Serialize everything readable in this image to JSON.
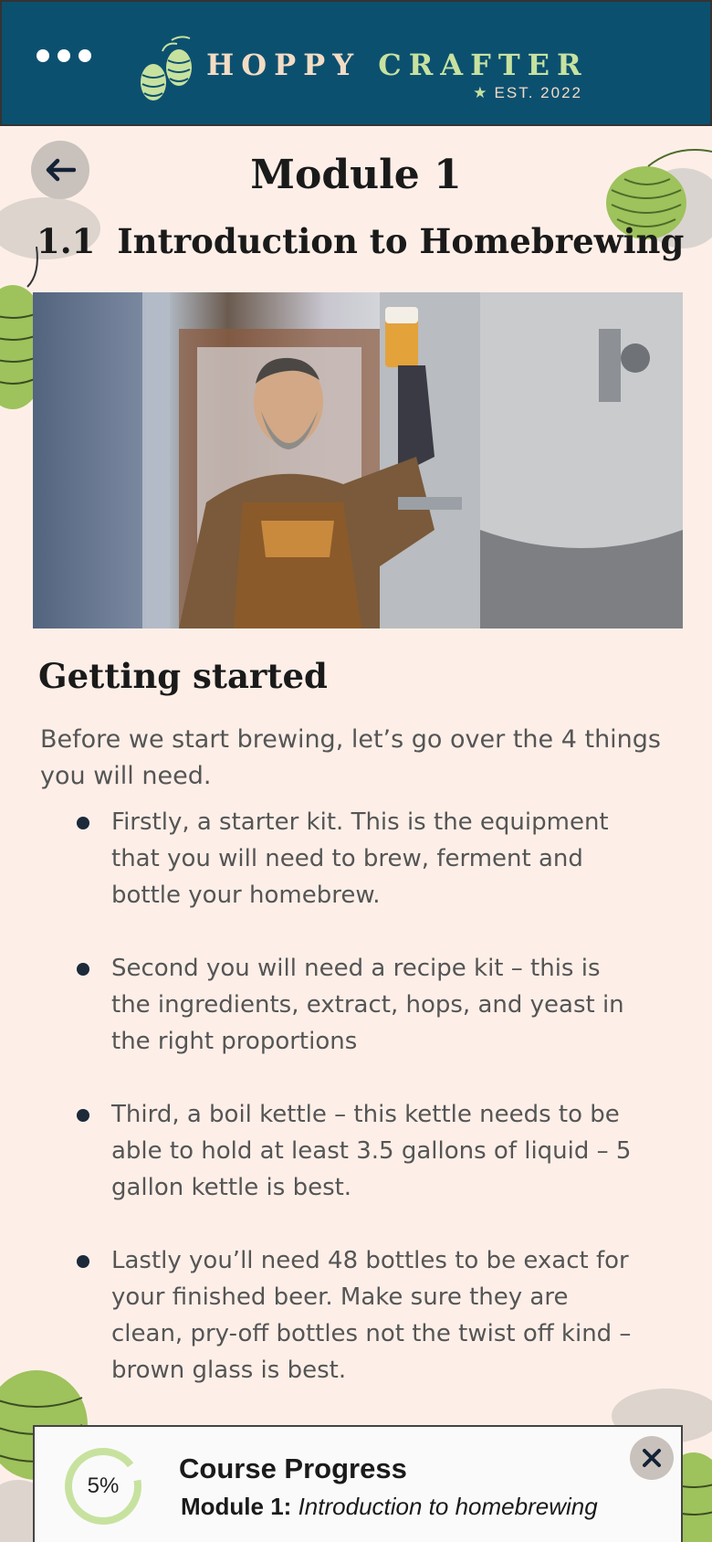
{
  "header": {
    "brand_part1": "HOPPY",
    "brand_part2": "CRAFTER",
    "established": "EST. 2022",
    "menu_icon": "more-dots-icon",
    "logo_icon": "hops-icon"
  },
  "page": {
    "back_icon": "arrow-left-icon",
    "module_title": "Module 1",
    "section_number": "1.1",
    "section_title": "Introduction to Homebrewing",
    "hero_image": "brewer-holding-beer-photo",
    "heading": "Getting started",
    "intro": "Before we start brewing, let’s go over the 4 things you will need.",
    "items": [
      "Firstly, a starter kit. This is the equipment that you will need to brew, ferment and bottle your homebrew.",
      "Second you will need a recipe kit – this is the ingredients, extract, hops, and yeast in the right proportions",
      "Third, a boil kettle – this kettle needs to be able to hold at least 3.5 gallons of liquid – 5 gallon kettle is best.",
      "Lastly you’ll need 48 bottles to be exact for your finished beer. Make sure they are clean, pry-off bottles not the twist off kind – brown glass is best."
    ]
  },
  "progress": {
    "percent_label": "5%",
    "percent_value": 0.05,
    "title": "Course Progress",
    "module_label": "Module 1:",
    "module_name": "Introduction to homebrewing",
    "close_icon": "close-icon"
  },
  "colors": {
    "header_bg": "#0c5070",
    "page_bg": "#fdefe8",
    "brand_green": "#c7e29f",
    "brand_cream": "#f3dcc4",
    "progress_ring": "#c7e29f"
  }
}
